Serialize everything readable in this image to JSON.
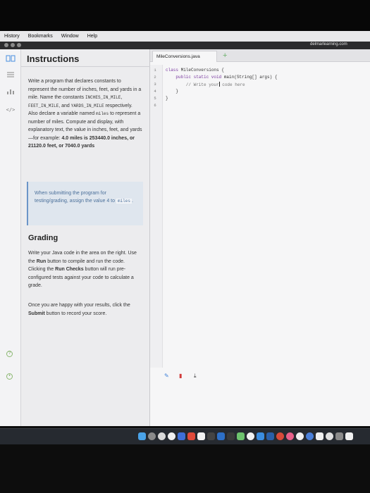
{
  "menubar": {
    "items": [
      "History",
      "Bookmarks",
      "Window",
      "Help"
    ]
  },
  "browser": {
    "url": "delmarlearning.com"
  },
  "sidebar": {
    "icons": [
      "book-icon",
      "list-icon",
      "chart-icon",
      "code-icon",
      "help-icon",
      "settings-icon"
    ]
  },
  "instructions": {
    "title": "Instructions",
    "p1_a": "Write a program that declares constants to represent the number of inches, feet, and yards in a mile. Name the constants ",
    "const_inches": "INCHES_IN_MILE",
    "sep1": ", ",
    "const_feet": "FEET_IN_MILE",
    "sep2": ", and ",
    "const_yards": "YARDS_IN_MILE",
    "p1_b": " respectively. Also declare a variable named ",
    "var_miles": "miles",
    "p1_c": " to represent a number of miles. Compute and display, with explanatory text, the value in inches, feet, and yards—for example: ",
    "example": "4.0 miles is 253440.0 inches, or 21120.0 feet, or 7040.0 yards",
    "callout_a": "When submitting the program for testing/grading, assign the value 4 to ",
    "callout_var": "miles",
    "callout_b": ".",
    "grading_title": "Grading",
    "g1_a": "Write your Java code in the area on the right. Use the ",
    "g1_run": "Run",
    "g1_b": " button to compile and run the code. Clicking the ",
    "g1_checks": "Run Checks",
    "g1_c": " button will run pre-configured tests against your code to calculate a grade.",
    "g2_a": "Once you are happy with your results, click the ",
    "g2_submit": "Submit",
    "g2_b": " button to record your score."
  },
  "editor": {
    "tab_label": "MileConversions.java",
    "add_tab": "+",
    "line_numbers": [
      "1",
      "2",
      "3",
      "4",
      "5",
      "6"
    ],
    "lines": [
      {
        "kw": "class",
        "rest": " MileConversions {"
      },
      {
        "kw": "    public static void",
        "rest": " main(String[] args) {"
      },
      {
        "kw": "",
        "rest": "        // Write your",
        "caret_after": " code here"
      },
      {
        "kw": "",
        "rest": "    }"
      },
      {
        "kw": "",
        "rest": "}"
      },
      {
        "kw": "",
        "rest": ""
      }
    ],
    "tools": [
      "pencil-icon",
      "trash-icon",
      "download-icon"
    ]
  },
  "colors": {
    "accent_blue": "#4a8fe0",
    "callout_bg": "#dfe6ee",
    "keyword": "#7a3aa0"
  }
}
